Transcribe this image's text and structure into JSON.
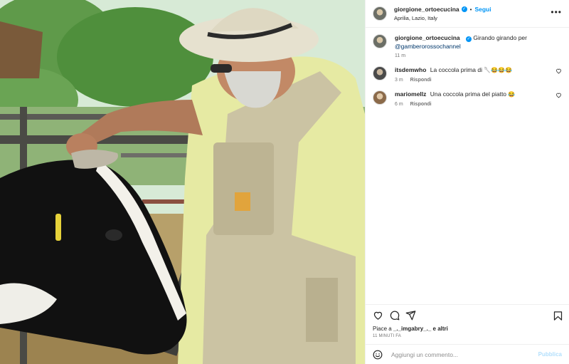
{
  "post": {
    "username": "giorgione_ortoecucina",
    "follow_label": "Segui",
    "location": "Aprilia, Lazio, Italy",
    "more_label": "•••"
  },
  "caption": {
    "username": "giorgione_ortoecucina",
    "text": "Girando girando per",
    "mention": "@gamberorossochannel",
    "time": "11 m"
  },
  "comments": [
    {
      "username": "itsdemwho",
      "text": "La coccola prima di",
      "emojis": "🥄😂😂😂",
      "time": "3 m",
      "reply_label": "Rispondi"
    },
    {
      "username": "mariomellz",
      "text": "Una coccola prima del piatto",
      "emojis": "😂",
      "time": "6 m",
      "reply_label": "Rispondi"
    }
  ],
  "likes": {
    "prefix": "Piace a",
    "user": "_._imgabry_._",
    "suffix": "e altri"
  },
  "timestamp": "11 MINUTI FA",
  "add_comment": {
    "placeholder": "Aggiungi un commento...",
    "publish_label": "Pubblica"
  },
  "icons": [
    "heart-icon",
    "comment-icon",
    "share-icon",
    "bookmark-icon",
    "emoji-icon",
    "verified-icon",
    "more-icon"
  ],
  "colors": {
    "accent": "#0095f6",
    "publish_disabled": "#b2dffc",
    "text": "#262626",
    "muted": "#737373"
  }
}
